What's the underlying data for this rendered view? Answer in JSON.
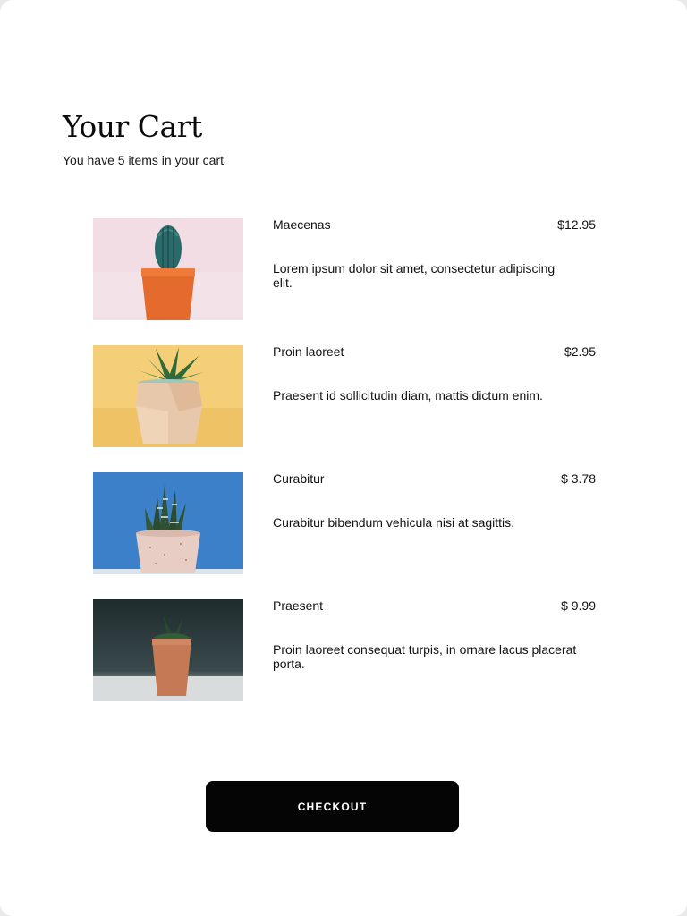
{
  "header": {
    "title": "Your Cart",
    "subtitle": "You have 5 items in your cart"
  },
  "items": [
    {
      "name": "Maecenas",
      "price": "$12.95",
      "description": "Lorem ipsum dolor sit amet, consectetur adipiscing elit.",
      "image_icon": "cactus-in-orange-pot-image"
    },
    {
      "name": "Proin laoreet",
      "price": "$2.95",
      "description": "Praesent id sollicitudin diam, mattis dictum enim.",
      "image_icon": "succulent-in-wooden-pot-image"
    },
    {
      "name": "Curabitur",
      "price": "$ 3.78",
      "description": "Curabitur bibendum vehicula nisi at sagittis.",
      "image_icon": "zebra-plant-in-speckled-pot-image"
    },
    {
      "name": "Praesent",
      "price": "$ 9.99",
      "description": "Proin laoreet consequat turpis, in ornare lacus placerat porta.",
      "image_icon": "succulent-in-terracotta-pot-image"
    }
  ],
  "checkout": {
    "label": "CHECKOUT"
  },
  "colors": {
    "background": "#ffffff",
    "text": "#111111",
    "button": "#050505",
    "button_text": "#ffffff"
  }
}
